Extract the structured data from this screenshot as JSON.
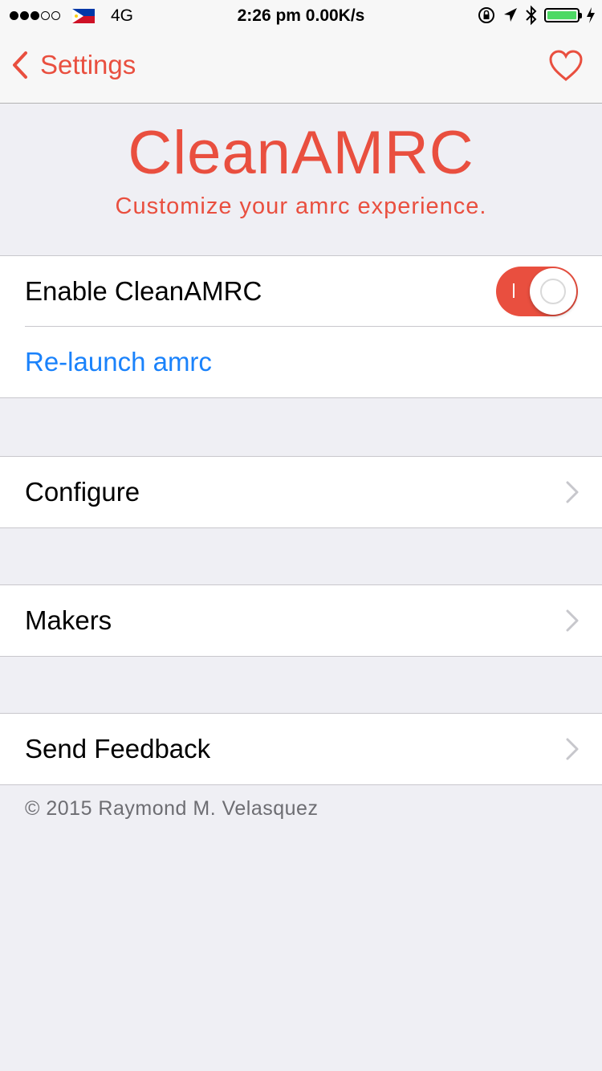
{
  "status_bar": {
    "carrier": "4G",
    "time": "2:26 pm 0.00K/s",
    "signal_bars": 5,
    "signal_filled": 3,
    "battery_color": "#4cd964"
  },
  "nav": {
    "back_label": "Settings",
    "accent_color": "#e94f3f",
    "right_icon": "heart-icon"
  },
  "header": {
    "title": "CleanAMRC",
    "subtitle": "Customize your amrc experience."
  },
  "sections": {
    "main": {
      "enable_label": "Enable CleanAMRC",
      "enable_on": true,
      "relaunch_label": "Re-launch amrc"
    },
    "configure_label": "Configure",
    "makers_label": "Makers",
    "feedback_label": "Send Feedback"
  },
  "footer": {
    "copyright": "© 2015 Raymond M. Velasquez"
  }
}
